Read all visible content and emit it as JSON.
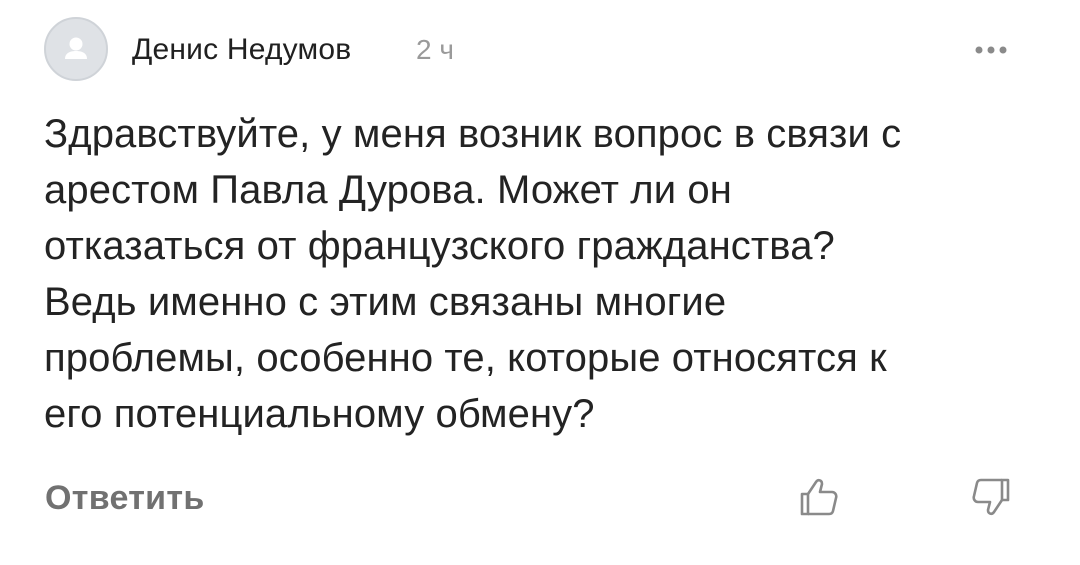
{
  "comment": {
    "author": "Денис Недумов",
    "time": "2 ч",
    "text": "Здравствуйте, у меня возник вопрос в связи с\nарестом Павла Дурова. Может ли он\nотказаться от французского гражданства?\nВедь именно с этим связаны многие\nпроблемы, особенно те, которые относятся к\nего потенциальному обмену?",
    "reply_label": "Ответить"
  },
  "icons": {
    "avatar": "user-placeholder-icon",
    "more": "more-horizontal-icon",
    "like": "thumbs-up-icon",
    "dislike": "thumbs-down-icon"
  },
  "colors": {
    "text": "#232323",
    "muted": "#9a9a9a",
    "reply": "#717171",
    "icon": "#8a8a8a",
    "avatar_bg": "#dfe2e6"
  }
}
